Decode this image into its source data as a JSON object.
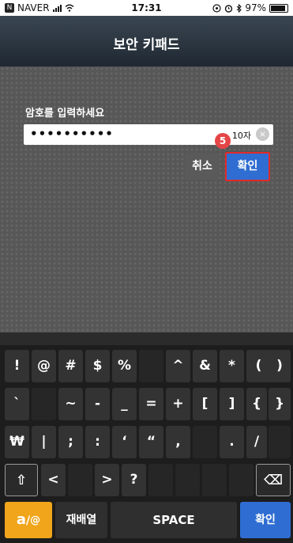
{
  "status": {
    "carrier": "NAVER",
    "time": "17:31",
    "battery": "97%",
    "carrier_badge": "N"
  },
  "title": "보안 키패드",
  "prompt": "암호를 입력하세요",
  "password": {
    "masked": "••••••••••",
    "count": "10자",
    "clear_icon": "×"
  },
  "step_badge": "5",
  "buttons": {
    "cancel": "취소",
    "confirm": "확인"
  },
  "keyboard": {
    "row1": [
      "!",
      "@",
      "#",
      "$",
      "%",
      "",
      "^",
      "&",
      "*",
      "(",
      ")"
    ],
    "row2": [
      "`",
      "",
      "~",
      "-",
      "_",
      "=",
      "+",
      "[",
      "]",
      "{",
      "}"
    ],
    "row3": [
      "₩",
      "|",
      ";",
      ":",
      "‘",
      "“",
      ",",
      "",
      "",
      ".",
      "/"
    ],
    "row4": [
      "⇧",
      "<",
      "",
      ">",
      "?",
      "",
      "",
      "",
      "",
      "",
      "⌫"
    ],
    "row5": {
      "mode": "a/@",
      "mode_a": "a",
      "mode_at": "@",
      "shuffle": "재배열",
      "space": "SPACE",
      "confirm": "확인"
    }
  },
  "colors": {
    "accent_blue": "#2f6dd2",
    "highlight_red": "#e12a2a",
    "badge_red": "#e64547",
    "mode_orange": "#f0a51b"
  }
}
